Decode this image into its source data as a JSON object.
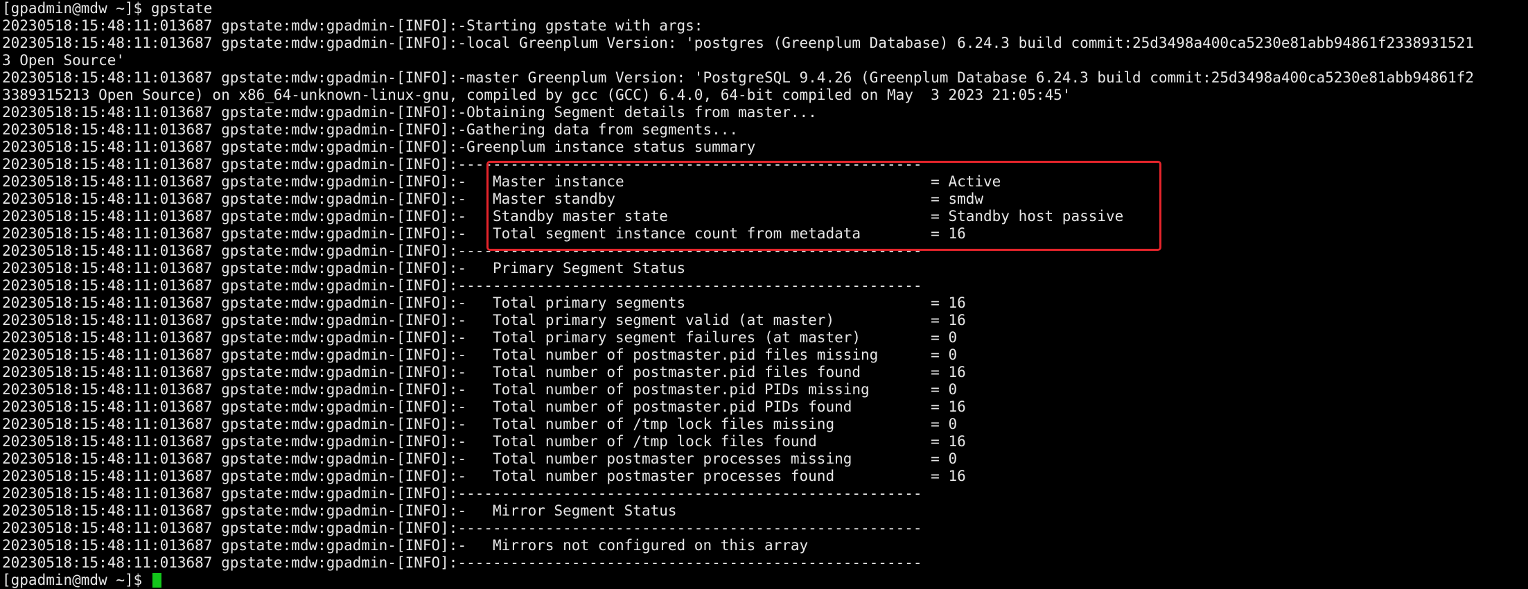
{
  "terminal": {
    "cursor_color": "#13c51b",
    "highlight_color": "#e5242b",
    "prompt_first": "[gpadmin@mdw ~]$ gpstate",
    "prompt_last": "[gpadmin@mdw ~]$ ",
    "lines": [
      "20230518:15:48:11:013687 gpstate:mdw:gpadmin-[INFO]:-Starting gpstate with args:",
      "20230518:15:48:11:013687 gpstate:mdw:gpadmin-[INFO]:-local Greenplum Version: 'postgres (Greenplum Database) 6.24.3 build commit:25d3498a400ca5230e81abb94861f2338931521",
      "3 Open Source'",
      "20230518:15:48:11:013687 gpstate:mdw:gpadmin-[INFO]:-master Greenplum Version: 'PostgreSQL 9.4.26 (Greenplum Database 6.24.3 build commit:25d3498a400ca5230e81abb94861f2",
      "3389315213 Open Source) on x86_64-unknown-linux-gnu, compiled by gcc (GCC) 6.4.0, 64-bit compiled on May  3 2023 21:05:45'",
      "20230518:15:48:11:013687 gpstate:mdw:gpadmin-[INFO]:-Obtaining Segment details from master...",
      "20230518:15:48:11:013687 gpstate:mdw:gpadmin-[INFO]:-Gathering data from segments...",
      "20230518:15:48:11:013687 gpstate:mdw:gpadmin-[INFO]:-Greenplum instance status summary",
      "20230518:15:48:11:013687 gpstate:mdw:gpadmin-[INFO]:-----------------------------------------------------",
      "20230518:15:48:11:013687 gpstate:mdw:gpadmin-[INFO]:-   Master instance                                   = Active",
      "20230518:15:48:11:013687 gpstate:mdw:gpadmin-[INFO]:-   Master standby                                    = smdw",
      "20230518:15:48:11:013687 gpstate:mdw:gpadmin-[INFO]:-   Standby master state                              = Standby host passive",
      "20230518:15:48:11:013687 gpstate:mdw:gpadmin-[INFO]:-   Total segment instance count from metadata        = 16",
      "20230518:15:48:11:013687 gpstate:mdw:gpadmin-[INFO]:-----------------------------------------------------",
      "20230518:15:48:11:013687 gpstate:mdw:gpadmin-[INFO]:-   Primary Segment Status",
      "20230518:15:48:11:013687 gpstate:mdw:gpadmin-[INFO]:-----------------------------------------------------",
      "20230518:15:48:11:013687 gpstate:mdw:gpadmin-[INFO]:-   Total primary segments                            = 16",
      "20230518:15:48:11:013687 gpstate:mdw:gpadmin-[INFO]:-   Total primary segment valid (at master)           = 16",
      "20230518:15:48:11:013687 gpstate:mdw:gpadmin-[INFO]:-   Total primary segment failures (at master)        = 0",
      "20230518:15:48:11:013687 gpstate:mdw:gpadmin-[INFO]:-   Total number of postmaster.pid files missing      = 0",
      "20230518:15:48:11:013687 gpstate:mdw:gpadmin-[INFO]:-   Total number of postmaster.pid files found        = 16",
      "20230518:15:48:11:013687 gpstate:mdw:gpadmin-[INFO]:-   Total number of postmaster.pid PIDs missing       = 0",
      "20230518:15:48:11:013687 gpstate:mdw:gpadmin-[INFO]:-   Total number of postmaster.pid PIDs found         = 16",
      "20230518:15:48:11:013687 gpstate:mdw:gpadmin-[INFO]:-   Total number of /tmp lock files missing           = 0",
      "20230518:15:48:11:013687 gpstate:mdw:gpadmin-[INFO]:-   Total number of /tmp lock files found             = 16",
      "20230518:15:48:11:013687 gpstate:mdw:gpadmin-[INFO]:-   Total number postmaster processes missing         = 0",
      "20230518:15:48:11:013687 gpstate:mdw:gpadmin-[INFO]:-   Total number postmaster processes found           = 16",
      "20230518:15:48:11:013687 gpstate:mdw:gpadmin-[INFO]:-----------------------------------------------------",
      "20230518:15:48:11:013687 gpstate:mdw:gpadmin-[INFO]:-   Mirror Segment Status",
      "20230518:15:48:11:013687 gpstate:mdw:gpadmin-[INFO]:-----------------------------------------------------",
      "20230518:15:48:11:013687 gpstate:mdw:gpadmin-[INFO]:-   Mirrors not configured on this array",
      "20230518:15:48:11:013687 gpstate:mdw:gpadmin-[INFO]:-----------------------------------------------------"
    ]
  }
}
